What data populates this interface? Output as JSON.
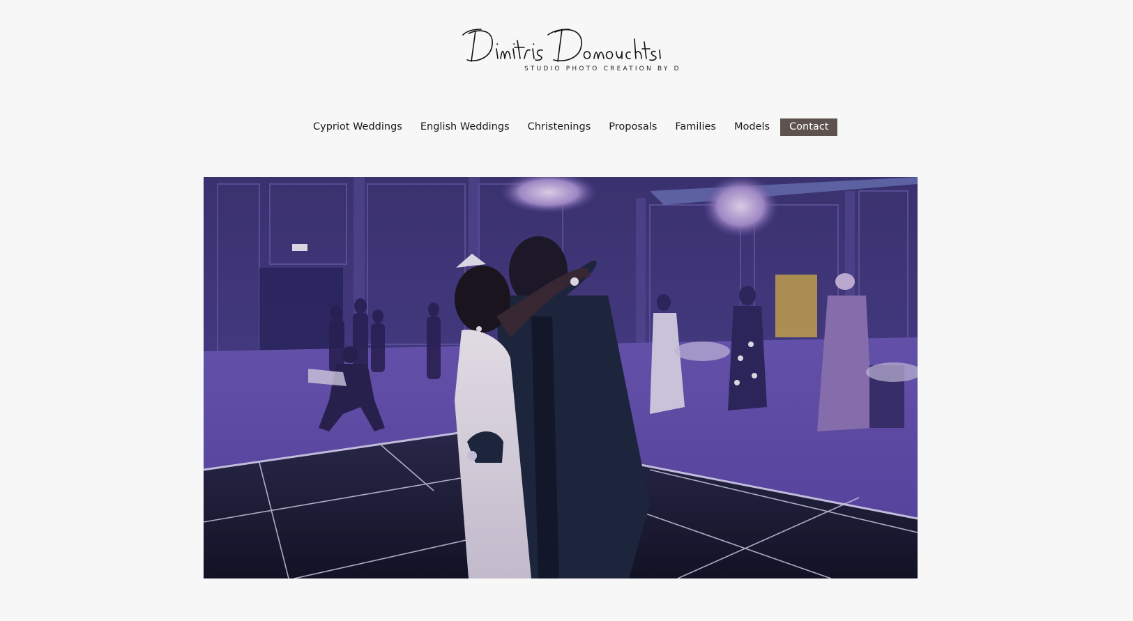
{
  "logo": {
    "name": "Dimitris Domouchtsis",
    "tagline": "STUDIO PHOTO CREATION BY D"
  },
  "nav": {
    "items": [
      {
        "label": "Cypriot Weddings"
      },
      {
        "label": "English Weddings"
      },
      {
        "label": "Christenings"
      },
      {
        "label": "Proposals"
      },
      {
        "label": "Families"
      },
      {
        "label": "Models"
      },
      {
        "label": "Contact",
        "active": true
      }
    ]
  },
  "hero": {
    "alt": ""
  },
  "colors": {
    "background": "#f7f7f7",
    "nav_active": "#5d524d",
    "nav_active_text": "#ffffff",
    "text": "#1a1a1a"
  }
}
